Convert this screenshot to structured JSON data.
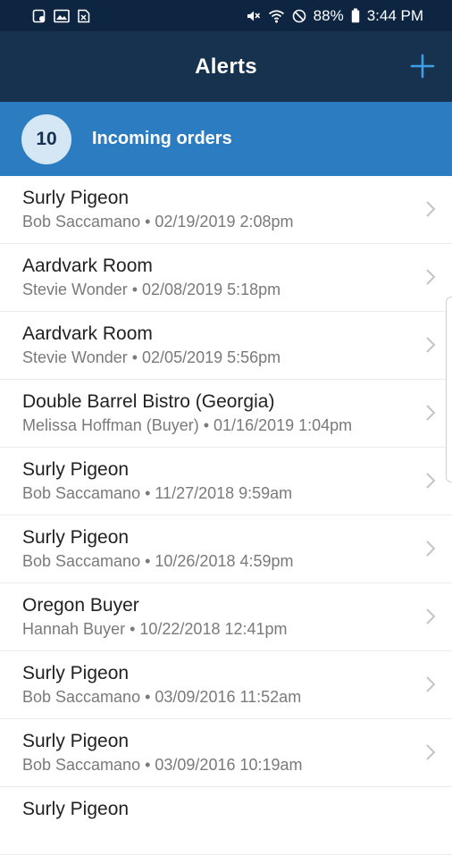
{
  "status_bar": {
    "battery": "88%",
    "time": "3:44 PM",
    "left_icons": [
      "message-notification-icon",
      "image-notification-icon",
      "file-notification-icon"
    ],
    "right_icons": [
      "mute-icon",
      "wifi-icon",
      "do-not-disturb-icon",
      "battery-icon"
    ]
  },
  "header": {
    "title": "Alerts",
    "add_icon": "plus-icon"
  },
  "banner": {
    "count": "10",
    "label": "Incoming orders"
  },
  "orders": [
    {
      "title": "Surly Pigeon",
      "subtitle": "Bob Saccamano • 02/19/2019 2:08pm"
    },
    {
      "title": "Aardvark Room",
      "subtitle": "Stevie Wonder • 02/08/2019 5:18pm"
    },
    {
      "title": "Aardvark Room",
      "subtitle": "Stevie Wonder • 02/05/2019 5:56pm"
    },
    {
      "title": "Double Barrel Bistro (Georgia)",
      "subtitle": "Melissa Hoffman (Buyer) • 01/16/2019 1:04pm"
    },
    {
      "title": "Surly Pigeon",
      "subtitle": "Bob Saccamano • 11/27/2018 9:59am"
    },
    {
      "title": "Surly Pigeon",
      "subtitle": "Bob Saccamano • 10/26/2018 4:59pm"
    },
    {
      "title": "Oregon Buyer",
      "subtitle": "Hannah Buyer • 10/22/2018 12:41pm"
    },
    {
      "title": "Surly Pigeon",
      "subtitle": "Bob Saccamano • 03/09/2016 11:52am"
    },
    {
      "title": "Surly Pigeon",
      "subtitle": "Bob Saccamano • 03/09/2016 10:19am"
    },
    {
      "title": "Surly Pigeon",
      "subtitle": ""
    }
  ],
  "colors": {
    "status_bar": "#0d2540",
    "header": "#17324f",
    "banner": "#2b7cc0",
    "accent": "#3fa0e8",
    "count_circle": "#d5e6f4"
  }
}
